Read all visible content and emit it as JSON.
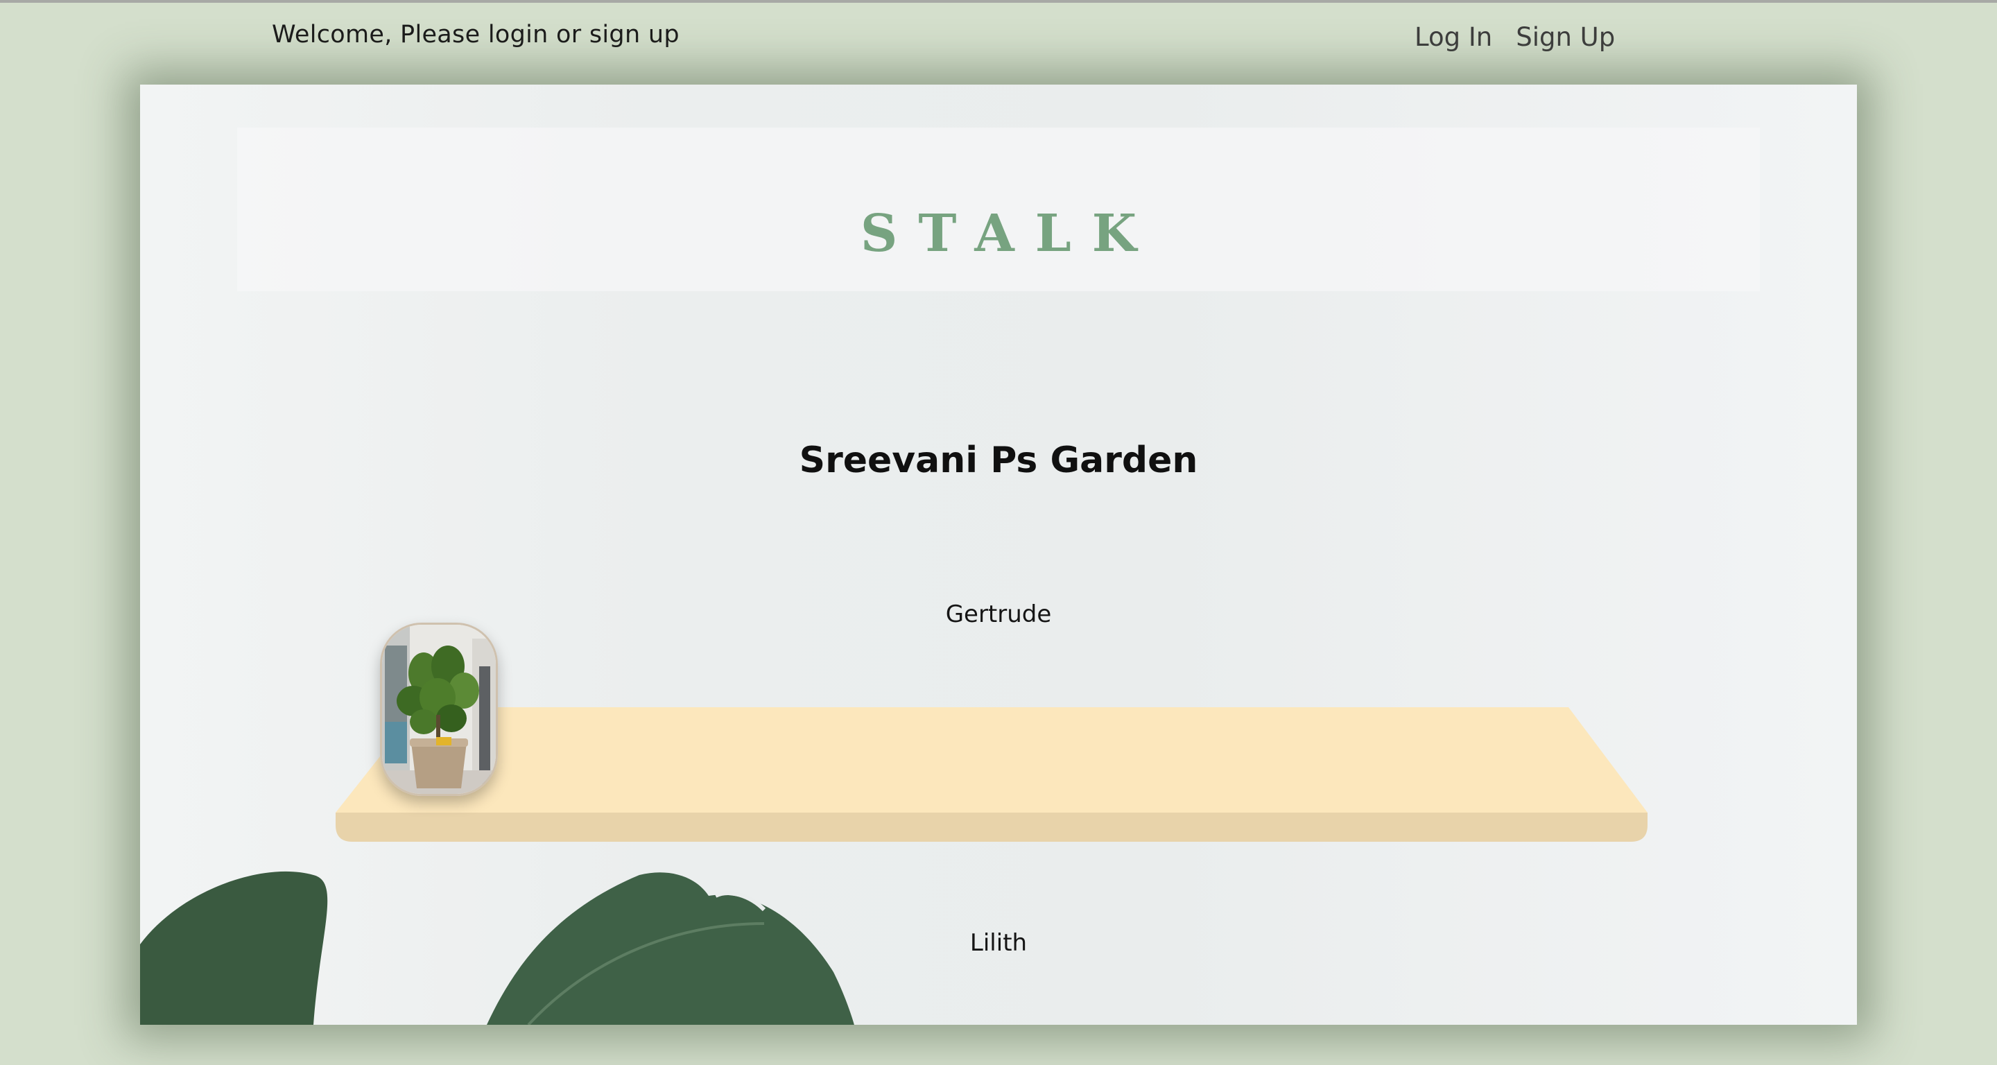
{
  "header": {
    "welcome": "Welcome, Please login or sign up",
    "login_label": "Log In",
    "signup_label": "Sign Up"
  },
  "main": {
    "logo": "STALK",
    "garden_title": "Sreevani Ps Garden",
    "plants": [
      {
        "name": "Gertrude"
      },
      {
        "name": "Lilith"
      }
    ]
  },
  "colors": {
    "background": "#d4dfcc",
    "logo": "#77a380",
    "shelf_top": "#fce7bc",
    "shelf_front": "#e8d3aa"
  },
  "icons": {
    "plant_photo": "fiddle-leaf-fig-in-pot-icon",
    "decor": "monstera-leaf-icon"
  }
}
